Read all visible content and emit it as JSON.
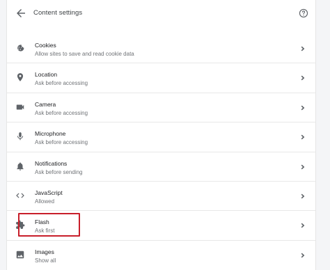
{
  "header": {
    "title": "Content settings",
    "back_icon": "arrow-back-icon",
    "help_icon": "help-circle-icon"
  },
  "settings": [
    {
      "id": "cookies",
      "label": "Cookies",
      "sublabel": "Allow sites to save and read cookie data",
      "icon": "cookie-icon"
    },
    {
      "id": "location",
      "label": "Location",
      "sublabel": "Ask before accessing",
      "icon": "location-pin-icon"
    },
    {
      "id": "camera",
      "label": "Camera",
      "sublabel": "Ask before accessing",
      "icon": "camera-icon"
    },
    {
      "id": "microphone",
      "label": "Microphone",
      "sublabel": "Ask before accessing",
      "icon": "microphone-icon"
    },
    {
      "id": "notifications",
      "label": "Notifications",
      "sublabel": "Ask before sending",
      "icon": "bell-icon"
    },
    {
      "id": "javascript",
      "label": "JavaScript",
      "sublabel": "Allowed",
      "icon": "code-brackets-icon"
    },
    {
      "id": "flash",
      "label": "Flash",
      "sublabel": "Ask first",
      "icon": "puzzle-piece-icon"
    },
    {
      "id": "images",
      "label": "Images",
      "sublabel": "Show all",
      "icon": "image-icon"
    }
  ],
  "highlighted_setting": "flash",
  "colors": {
    "highlight_border": "#c81e2a",
    "icon": "#5f6368",
    "text_primary": "#202124",
    "text_secondary": "#707377"
  }
}
